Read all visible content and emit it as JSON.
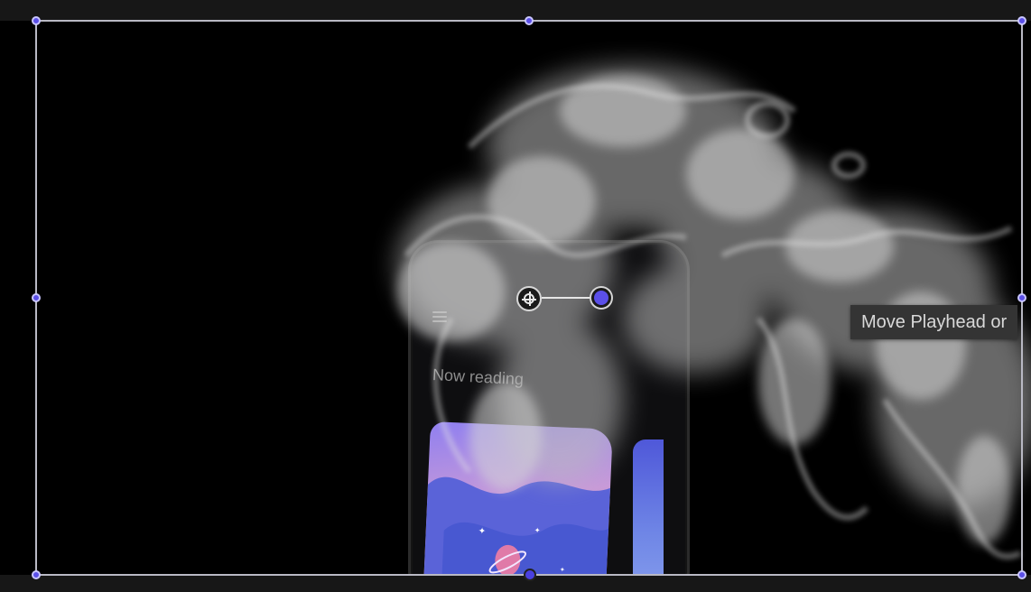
{
  "phone": {
    "section_title": "Now reading"
  },
  "tooltip": {
    "text": "Move Playhead or"
  },
  "colors": {
    "handle_fill": "#5b4fe8",
    "selection_stroke": "#b9b9c4",
    "canvas_background": "#000000"
  },
  "icons": {
    "menu": "hamburger-menu-icon",
    "anchor": "anchor-point-icon",
    "rotation": "rotation-handle-icon"
  }
}
